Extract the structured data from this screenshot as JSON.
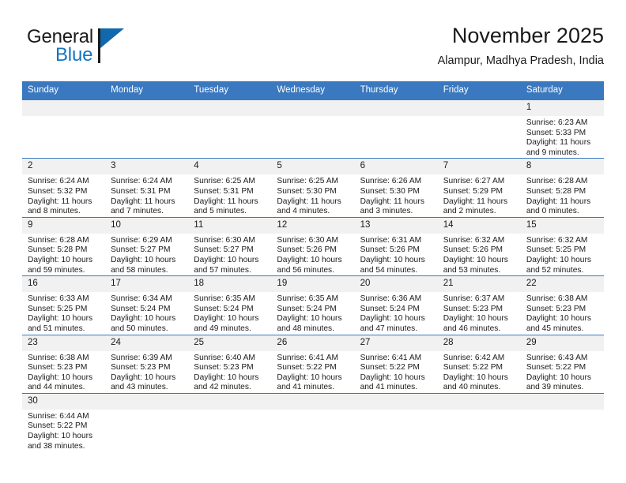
{
  "brand": {
    "name_top": "General",
    "name_bottom": "Blue",
    "flag_icon": "flag-icon",
    "color_blue": "#1474c4",
    "color_flag": "#1168ad"
  },
  "header": {
    "title": "November 2025",
    "subtitle": "Alampur, Madhya Pradesh, India"
  },
  "theme": {
    "header_blue": "#3a78bf",
    "daynum_gray": "#f1f1f1",
    "text": "#1a1a1a"
  },
  "calendar": {
    "weekday_headers": [
      "Sunday",
      "Monday",
      "Tuesday",
      "Wednesday",
      "Thursday",
      "Friday",
      "Saturday"
    ],
    "labels": {
      "sunrise": "Sunrise:",
      "sunset": "Sunset:",
      "daylight": "Daylight:"
    },
    "weeks": [
      [
        {
          "day": ""
        },
        {
          "day": ""
        },
        {
          "day": ""
        },
        {
          "day": ""
        },
        {
          "day": ""
        },
        {
          "day": ""
        },
        {
          "day": "1",
          "sunrise": "Sunrise: 6:23 AM",
          "sunset": "Sunset: 5:33 PM",
          "daylight": "Daylight: 11 hours and 9 minutes."
        }
      ],
      [
        {
          "day": "2",
          "sunrise": "Sunrise: 6:24 AM",
          "sunset": "Sunset: 5:32 PM",
          "daylight": "Daylight: 11 hours and 8 minutes."
        },
        {
          "day": "3",
          "sunrise": "Sunrise: 6:24 AM",
          "sunset": "Sunset: 5:31 PM",
          "daylight": "Daylight: 11 hours and 7 minutes."
        },
        {
          "day": "4",
          "sunrise": "Sunrise: 6:25 AM",
          "sunset": "Sunset: 5:31 PM",
          "daylight": "Daylight: 11 hours and 5 minutes."
        },
        {
          "day": "5",
          "sunrise": "Sunrise: 6:25 AM",
          "sunset": "Sunset: 5:30 PM",
          "daylight": "Daylight: 11 hours and 4 minutes."
        },
        {
          "day": "6",
          "sunrise": "Sunrise: 6:26 AM",
          "sunset": "Sunset: 5:30 PM",
          "daylight": "Daylight: 11 hours and 3 minutes."
        },
        {
          "day": "7",
          "sunrise": "Sunrise: 6:27 AM",
          "sunset": "Sunset: 5:29 PM",
          "daylight": "Daylight: 11 hours and 2 minutes."
        },
        {
          "day": "8",
          "sunrise": "Sunrise: 6:28 AM",
          "sunset": "Sunset: 5:28 PM",
          "daylight": "Daylight: 11 hours and 0 minutes."
        }
      ],
      [
        {
          "day": "9",
          "sunrise": "Sunrise: 6:28 AM",
          "sunset": "Sunset: 5:28 PM",
          "daylight": "Daylight: 10 hours and 59 minutes."
        },
        {
          "day": "10",
          "sunrise": "Sunrise: 6:29 AM",
          "sunset": "Sunset: 5:27 PM",
          "daylight": "Daylight: 10 hours and 58 minutes."
        },
        {
          "day": "11",
          "sunrise": "Sunrise: 6:30 AM",
          "sunset": "Sunset: 5:27 PM",
          "daylight": "Daylight: 10 hours and 57 minutes."
        },
        {
          "day": "12",
          "sunrise": "Sunrise: 6:30 AM",
          "sunset": "Sunset: 5:26 PM",
          "daylight": "Daylight: 10 hours and 56 minutes."
        },
        {
          "day": "13",
          "sunrise": "Sunrise: 6:31 AM",
          "sunset": "Sunset: 5:26 PM",
          "daylight": "Daylight: 10 hours and 54 minutes."
        },
        {
          "day": "14",
          "sunrise": "Sunrise: 6:32 AM",
          "sunset": "Sunset: 5:26 PM",
          "daylight": "Daylight: 10 hours and 53 minutes."
        },
        {
          "day": "15",
          "sunrise": "Sunrise: 6:32 AM",
          "sunset": "Sunset: 5:25 PM",
          "daylight": "Daylight: 10 hours and 52 minutes."
        }
      ],
      [
        {
          "day": "16",
          "sunrise": "Sunrise: 6:33 AM",
          "sunset": "Sunset: 5:25 PM",
          "daylight": "Daylight: 10 hours and 51 minutes."
        },
        {
          "day": "17",
          "sunrise": "Sunrise: 6:34 AM",
          "sunset": "Sunset: 5:24 PM",
          "daylight": "Daylight: 10 hours and 50 minutes."
        },
        {
          "day": "18",
          "sunrise": "Sunrise: 6:35 AM",
          "sunset": "Sunset: 5:24 PM",
          "daylight": "Daylight: 10 hours and 49 minutes."
        },
        {
          "day": "19",
          "sunrise": "Sunrise: 6:35 AM",
          "sunset": "Sunset: 5:24 PM",
          "daylight": "Daylight: 10 hours and 48 minutes."
        },
        {
          "day": "20",
          "sunrise": "Sunrise: 6:36 AM",
          "sunset": "Sunset: 5:24 PM",
          "daylight": "Daylight: 10 hours and 47 minutes."
        },
        {
          "day": "21",
          "sunrise": "Sunrise: 6:37 AM",
          "sunset": "Sunset: 5:23 PM",
          "daylight": "Daylight: 10 hours and 46 minutes."
        },
        {
          "day": "22",
          "sunrise": "Sunrise: 6:38 AM",
          "sunset": "Sunset: 5:23 PM",
          "daylight": "Daylight: 10 hours and 45 minutes."
        }
      ],
      [
        {
          "day": "23",
          "sunrise": "Sunrise: 6:38 AM",
          "sunset": "Sunset: 5:23 PM",
          "daylight": "Daylight: 10 hours and 44 minutes."
        },
        {
          "day": "24",
          "sunrise": "Sunrise: 6:39 AM",
          "sunset": "Sunset: 5:23 PM",
          "daylight": "Daylight: 10 hours and 43 minutes."
        },
        {
          "day": "25",
          "sunrise": "Sunrise: 6:40 AM",
          "sunset": "Sunset: 5:23 PM",
          "daylight": "Daylight: 10 hours and 42 minutes."
        },
        {
          "day": "26",
          "sunrise": "Sunrise: 6:41 AM",
          "sunset": "Sunset: 5:22 PM",
          "daylight": "Daylight: 10 hours and 41 minutes."
        },
        {
          "day": "27",
          "sunrise": "Sunrise: 6:41 AM",
          "sunset": "Sunset: 5:22 PM",
          "daylight": "Daylight: 10 hours and 41 minutes."
        },
        {
          "day": "28",
          "sunrise": "Sunrise: 6:42 AM",
          "sunset": "Sunset: 5:22 PM",
          "daylight": "Daylight: 10 hours and 40 minutes."
        },
        {
          "day": "29",
          "sunrise": "Sunrise: 6:43 AM",
          "sunset": "Sunset: 5:22 PM",
          "daylight": "Daylight: 10 hours and 39 minutes."
        }
      ],
      [
        {
          "day": "30",
          "sunrise": "Sunrise: 6:44 AM",
          "sunset": "Sunset: 5:22 PM",
          "daylight": "Daylight: 10 hours and 38 minutes."
        },
        {
          "day": ""
        },
        {
          "day": ""
        },
        {
          "day": ""
        },
        {
          "day": ""
        },
        {
          "day": ""
        },
        {
          "day": ""
        }
      ]
    ]
  }
}
